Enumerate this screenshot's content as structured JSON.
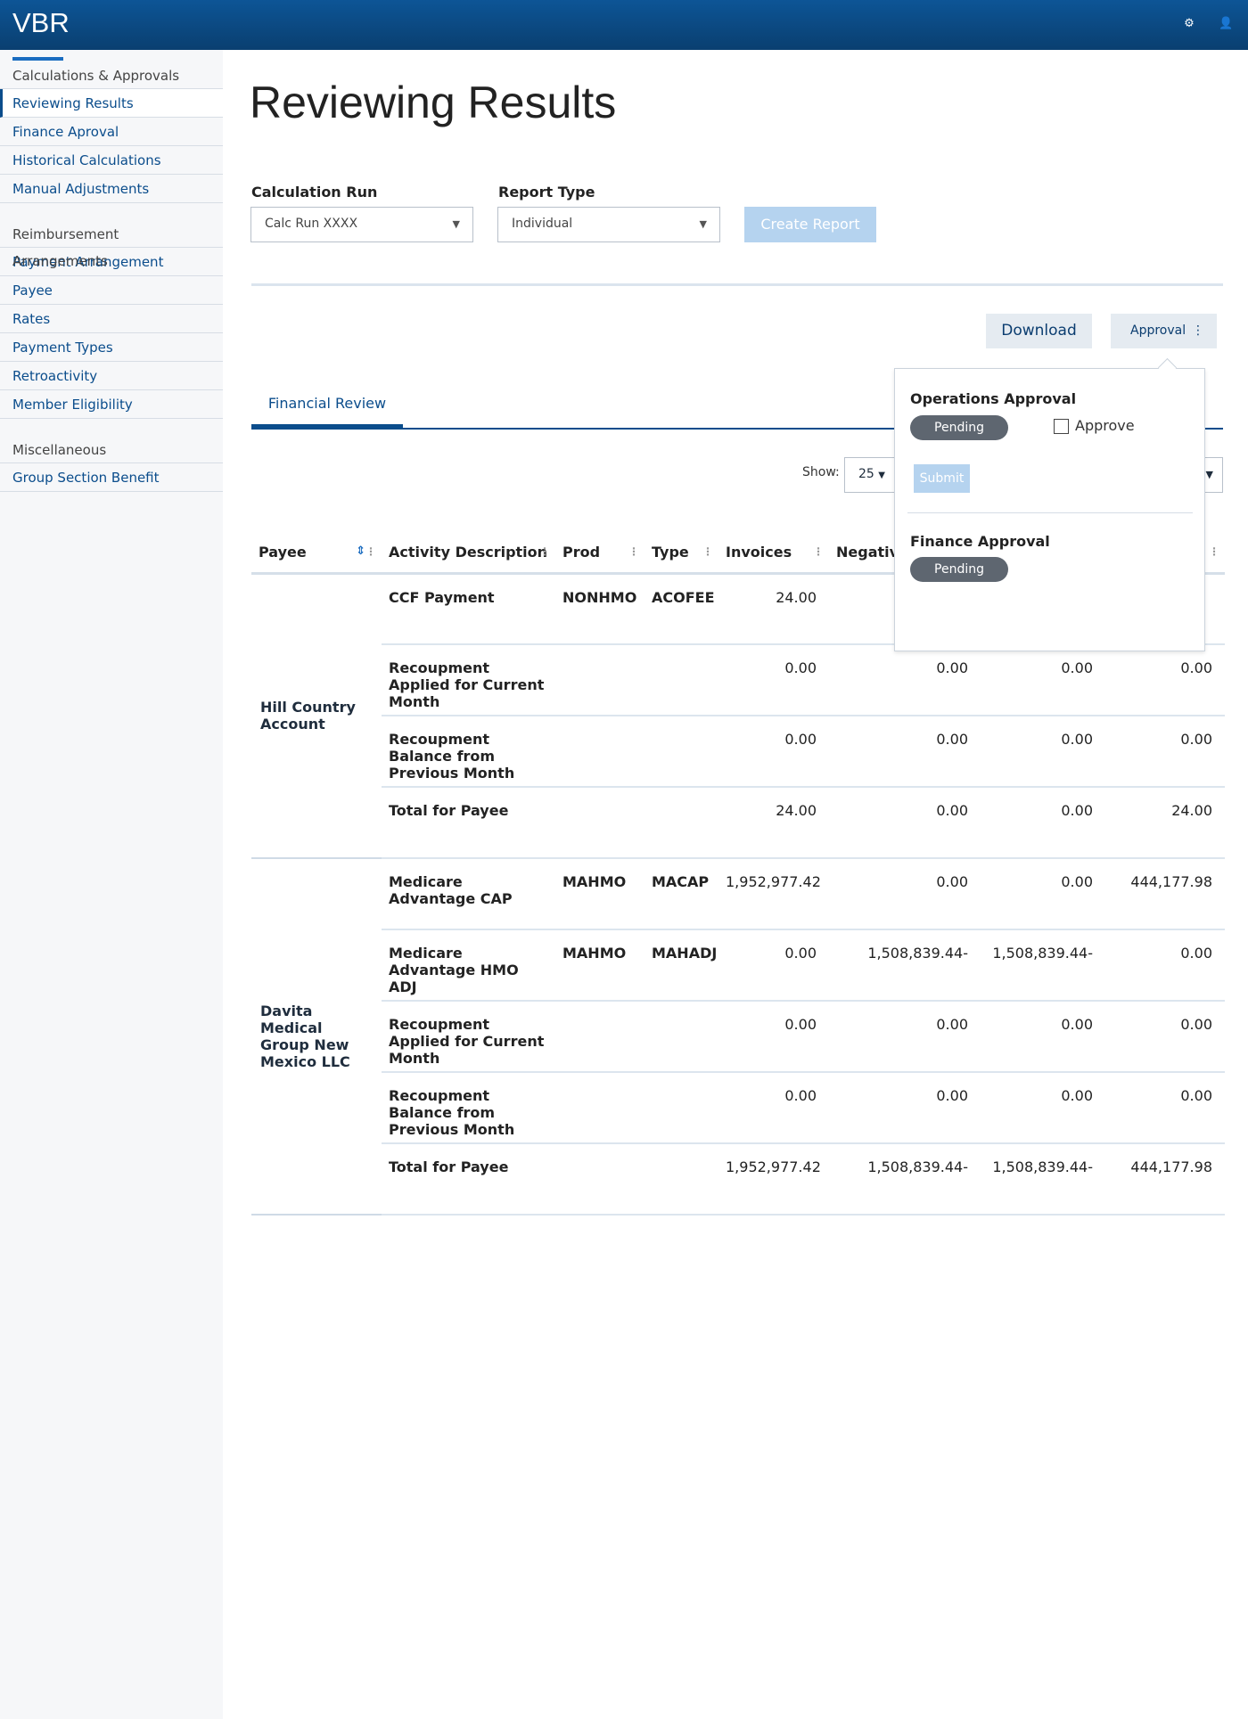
{
  "app": {
    "title": "VBR",
    "icons": [
      "settings-icon",
      "user-icon"
    ]
  },
  "sidebar": {
    "sections": [
      {
        "title": "Calculations & Approvals",
        "items": [
          "Reviewing Results",
          "Finance Aproval",
          "Historical Calculations",
          "Manual Adjustments"
        ]
      },
      {
        "title": "Reimbursement Arrangements",
        "items": [
          "Payment Arrangement",
          "Payee",
          "Rates",
          "Payment Types",
          "Retroactivity",
          "Member Eligibility"
        ]
      },
      {
        "title": "Miscellaneous",
        "items": [
          "Group Section Benefit"
        ]
      }
    ],
    "active": "Reviewing Results"
  },
  "page": {
    "title": "Reviewing Results"
  },
  "form": {
    "calc_run_label": "Calculation Run",
    "calc_run_value": "Calc Run XXXX",
    "report_type_label": "Report Type",
    "report_type_value": "Individual",
    "create_label": "Create Report"
  },
  "actions": {
    "download": "Download",
    "approval": "Approval"
  },
  "tabs": [
    "Financial Review"
  ],
  "show": {
    "label": "Show:",
    "value": "25"
  },
  "table": {
    "headers": [
      "Payee",
      "Activity Description",
      "Prod",
      "Type",
      "Invoices",
      "Negative",
      "",
      ""
    ],
    "groups": [
      {
        "payee": "Hill Country Account",
        "rows": [
          [
            "CCF Payment",
            "NONHMO",
            "ACOFEE",
            "24.00",
            "",
            "",
            ""
          ],
          [
            "Recoupment Applied for Current Month",
            "",
            "",
            "0.00",
            "0.00",
            "0.00",
            "0.00"
          ],
          [
            "Recoupment Balance from Previous Month",
            "",
            "",
            "0.00",
            "0.00",
            "0.00",
            "0.00"
          ],
          [
            "Total for Payee",
            "",
            "",
            "24.00",
            "0.00",
            "0.00",
            "24.00"
          ]
        ]
      },
      {
        "payee": "Davita Medical Group New Mexico LLC",
        "rows": [
          [
            "Medicare Advantage CAP",
            "MAHMO",
            "MACAP",
            "1,952,977.42",
            "0.00",
            "0.00",
            "444,177.98"
          ],
          [
            "Medicare Advantage HMO ADJ",
            "MAHMO",
            "MAHADJ",
            "0.00",
            "1,508,839.44-",
            "1,508,839.44-",
            "0.00"
          ],
          [
            "Recoupment Applied for Current Month",
            "",
            "",
            "0.00",
            "0.00",
            "0.00",
            "0.00"
          ],
          [
            "Recoupment Balance from Previous Month",
            "",
            "",
            "0.00",
            "0.00",
            "0.00",
            "0.00"
          ],
          [
            "Total for Payee",
            "",
            "",
            "1,952,977.42",
            "1,508,839.44-",
            "1,508,839.44-",
            "444,177.98"
          ]
        ]
      }
    ]
  },
  "popup": {
    "ops_title": "Operations Approval",
    "ops_status": "Pending",
    "approve_label": "Approve",
    "approve_checked": false,
    "submit": "Submit",
    "fin_title": "Finance Approval",
    "fin_status": "Pending"
  }
}
